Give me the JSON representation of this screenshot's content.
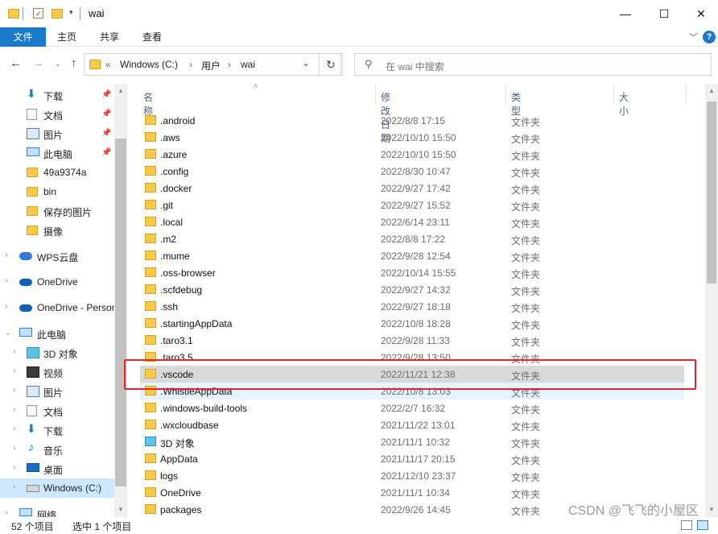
{
  "window": {
    "title": "wai",
    "controls": [
      "minimize-icon",
      "maximize-icon",
      "close-icon"
    ]
  },
  "ribbon": {
    "tabs": [
      "文件",
      "主页",
      "共享",
      "查看"
    ]
  },
  "address": {
    "overflow": "«",
    "segments": [
      "Windows (C:)",
      "用户",
      "wai"
    ]
  },
  "search": {
    "placeholder": "在 wai 中搜索"
  },
  "nav_pane": {
    "items": [
      {
        "label": "下载",
        "icon": "download-arrow-icon",
        "pinned": true
      },
      {
        "label": "文档",
        "icon": "document-icon",
        "pinned": true
      },
      {
        "label": "图片",
        "icon": "pictures-icon",
        "pinned": true
      },
      {
        "label": "此电脑",
        "icon": "computer-icon",
        "pinned": true
      },
      {
        "label": "49a9374a",
        "icon": "folder-icon"
      },
      {
        "label": "bin",
        "icon": "folder-icon"
      },
      {
        "label": "保存的图片",
        "icon": "folder-icon"
      },
      {
        "label": "摄像",
        "icon": "folder-icon"
      },
      {
        "label": "WPS云盘",
        "icon": "cloud-icon"
      },
      {
        "label": "OneDrive",
        "icon": "onedrive-cloud-icon"
      },
      {
        "label": "OneDrive - Personal",
        "icon": "onedrive-cloud-icon"
      },
      {
        "label": "此电脑",
        "icon": "computer-icon"
      },
      {
        "label": "3D 对象",
        "icon": "3d-objects-icon"
      },
      {
        "label": "视频",
        "icon": "video-icon"
      },
      {
        "label": "图片",
        "icon": "pictures-icon"
      },
      {
        "label": "文档",
        "icon": "document-icon"
      },
      {
        "label": "下载",
        "icon": "download-arrow-icon"
      },
      {
        "label": "音乐",
        "icon": "music-note-icon"
      },
      {
        "label": "桌面",
        "icon": "desktop-icon"
      },
      {
        "label": "Windows (C:)",
        "icon": "drive-icon",
        "selected": true
      },
      {
        "label": "网络",
        "icon": "network-icon"
      }
    ]
  },
  "columns": [
    "名称",
    "修改日期",
    "类型",
    "大小"
  ],
  "files": [
    {
      "name": ".android",
      "date": "2022/8/8 17:15",
      "type": "文件夹"
    },
    {
      "name": ".aws",
      "date": "2022/10/10 15:50",
      "type": "文件夹"
    },
    {
      "name": ".azure",
      "date": "2022/10/10 15:50",
      "type": "文件夹"
    },
    {
      "name": ".config",
      "date": "2022/8/30 10:47",
      "type": "文件夹"
    },
    {
      "name": ".docker",
      "date": "2022/9/27 17:42",
      "type": "文件夹"
    },
    {
      "name": ".git",
      "date": "2022/9/27 15:52",
      "type": "文件夹"
    },
    {
      "name": ".local",
      "date": "2022/6/14 23:11",
      "type": "文件夹"
    },
    {
      "name": ".m2",
      "date": "2022/8/8 17:22",
      "type": "文件夹"
    },
    {
      "name": ".mume",
      "date": "2022/9/28 12:54",
      "type": "文件夹"
    },
    {
      "name": ".oss-browser",
      "date": "2022/10/14 15:55",
      "type": "文件夹"
    },
    {
      "name": ".scfdebug",
      "date": "2022/9/27 14:32",
      "type": "文件夹"
    },
    {
      "name": ".ssh",
      "date": "2022/9/27 18:18",
      "type": "文件夹"
    },
    {
      "name": ".startingAppData",
      "date": "2022/10/8 18:28",
      "type": "文件夹"
    },
    {
      "name": ".taro3.1",
      "date": "2022/9/28 11:33",
      "type": "文件夹"
    },
    {
      "name": ".taro3.5",
      "date": "2022/9/28 13:50",
      "type": "文件夹"
    },
    {
      "name": ".vscode",
      "date": "2022/11/21 12:38",
      "type": "文件夹",
      "highlighted": true
    },
    {
      "name": ".WhistleAppData",
      "date": "2022/10/8 13:03",
      "type": "文件夹"
    },
    {
      "name": ".windows-build-tools",
      "date": "2022/2/7 16:32",
      "type": "文件夹"
    },
    {
      "name": ".wxcloudbase",
      "date": "2021/11/22 13:01",
      "type": "文件夹"
    },
    {
      "name": "3D 对象",
      "date": "2021/11/1 10:32",
      "type": "文件夹",
      "icon": "3d-objects-icon"
    },
    {
      "name": "AppData",
      "date": "2021/11/17 20:15",
      "type": "文件夹"
    },
    {
      "name": "logs",
      "date": "2021/12/10 23:37",
      "type": "文件夹"
    },
    {
      "name": "OneDrive",
      "date": "2021/11/1 10:34",
      "type": "文件夹"
    },
    {
      "name": "packages",
      "date": "2022/9/26 14:45",
      "type": "文件夹"
    }
  ],
  "status": {
    "count": "52 个项目",
    "selection": "选中 1 个项目"
  },
  "watermark": "CSDN @飞飞的小屋区",
  "colors": {
    "accent": "#1979ca",
    "selection": "#cce8ff",
    "highlight_box": "#e0262c",
    "folder": "#f5c94a"
  }
}
